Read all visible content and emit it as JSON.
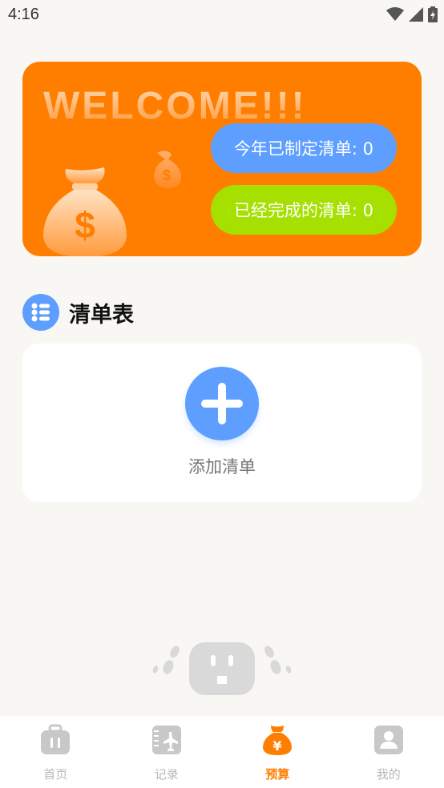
{
  "status_bar": {
    "time": "4:16"
  },
  "banner": {
    "welcome": "WELCOME!!!",
    "lists_created_this_year": "今年已制定清单: 0",
    "lists_completed": "已经完成的清单: 0"
  },
  "section": {
    "title": "清单表"
  },
  "card": {
    "add_label": "添加清单"
  },
  "tabs": [
    {
      "label": "首页",
      "icon": "luggage-icon",
      "active": false
    },
    {
      "label": "记录",
      "icon": "airplane-ticket-icon",
      "active": false
    },
    {
      "label": "预算",
      "icon": "money-bag-icon",
      "active": true
    },
    {
      "label": "我的",
      "icon": "profile-icon",
      "active": false
    }
  ],
  "colors": {
    "accent": "#ff7e00",
    "blue": "#5d9eff",
    "green": "#a6e000",
    "inactive": "#b8b8b8"
  }
}
